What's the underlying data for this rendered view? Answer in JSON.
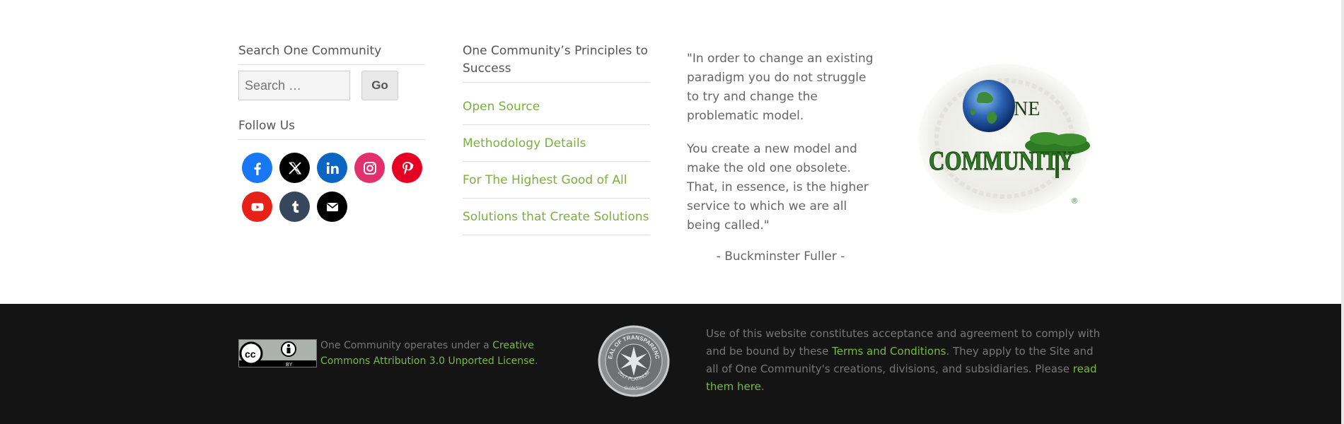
{
  "search": {
    "title": "Search One Community",
    "placeholder": "Search …",
    "go_label": "Go"
  },
  "follow": {
    "title": "Follow Us",
    "networks": [
      {
        "name": "facebook",
        "color": "#1877f2"
      },
      {
        "name": "x",
        "color": "#000000"
      },
      {
        "name": "linkedin",
        "color": "#0a66c2"
      },
      {
        "name": "instagram",
        "color": "#e1306c"
      },
      {
        "name": "pinterest",
        "color": "#e60023"
      },
      {
        "name": "youtube",
        "color": "#e62117"
      },
      {
        "name": "tumblr",
        "color": "#36465d"
      },
      {
        "name": "email",
        "color": "#000000"
      }
    ]
  },
  "principles": {
    "title": "One Community’s Principles to Success",
    "links": [
      "Open Source",
      "Methodology Details",
      "For The Highest Good of All",
      "Solutions that Create Solutions"
    ]
  },
  "quote": {
    "paragraph1": "\"In order to change an existing paradigm you do not struggle to try and change the problematic model.",
    "paragraph2": "You create a new model and make the old one obsolete. That, in essence, is the higher service to which we are all being called.\"",
    "author": "- Buckminster Fuller -"
  },
  "logo": {
    "word1": "NE",
    "word2": "COMMUNITY",
    "registered": "®"
  },
  "footer": {
    "cc_badge_text": "BY",
    "license_prefix": "One Community operates under a ",
    "license_link": "Creative Commons Attribution 3.0 Unported License",
    "license_suffix": ".",
    "seal_text_top": "SEAL OF TRANSPARENCY",
    "seal_text_bottom": "2017 PLATINUM",
    "seal_brand": "GuideStar",
    "legal_prefix": "Use of this website constitutes acceptance and agreement to comply with and be bound by these ",
    "legal_link1": "Terms and Conditions",
    "legal_middle": ". They apply to the Site and all of One Community's creations, divisions, and subsidiaries. Please ",
    "legal_link2": "read them here",
    "legal_suffix": "."
  },
  "colors": {
    "link_green": "#7ab040",
    "footer_bg": "#141414"
  }
}
